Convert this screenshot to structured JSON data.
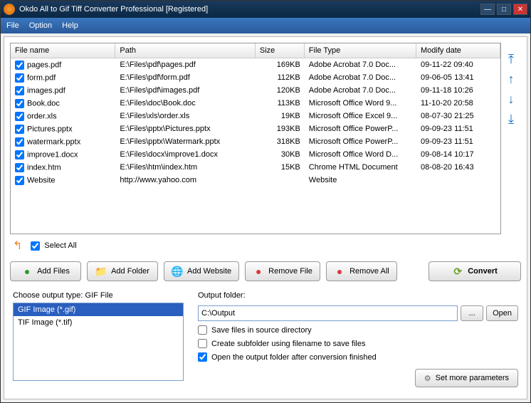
{
  "window": {
    "title": "Okdo All to Gif Tiff Converter Professional [Registered]"
  },
  "menu": {
    "file": "File",
    "option": "Option",
    "help": "Help"
  },
  "columns": {
    "name": "File name",
    "path": "Path",
    "size": "Size",
    "type": "File Type",
    "date": "Modify date"
  },
  "files": [
    {
      "checked": true,
      "name": "pages.pdf",
      "path": "E:\\Files\\pdf\\pages.pdf",
      "size": "169KB",
      "type": "Adobe Acrobat 7.0 Doc...",
      "date": "09-11-22 09:40"
    },
    {
      "checked": true,
      "name": "form.pdf",
      "path": "E:\\Files\\pdf\\form.pdf",
      "size": "112KB",
      "type": "Adobe Acrobat 7.0 Doc...",
      "date": "09-06-05 13:41"
    },
    {
      "checked": true,
      "name": "images.pdf",
      "path": "E:\\Files\\pdf\\images.pdf",
      "size": "120KB",
      "type": "Adobe Acrobat 7.0 Doc...",
      "date": "09-11-18 10:26"
    },
    {
      "checked": true,
      "name": "Book.doc",
      "path": "E:\\Files\\doc\\Book.doc",
      "size": "113KB",
      "type": "Microsoft Office Word 9...",
      "date": "11-10-20 20:58"
    },
    {
      "checked": true,
      "name": "order.xls",
      "path": "E:\\Files\\xls\\order.xls",
      "size": "19KB",
      "type": "Microsoft Office Excel 9...",
      "date": "08-07-30 21:25"
    },
    {
      "checked": true,
      "name": "Pictures.pptx",
      "path": "E:\\Files\\pptx\\Pictures.pptx",
      "size": "193KB",
      "type": "Microsoft Office PowerP...",
      "date": "09-09-23 11:51"
    },
    {
      "checked": true,
      "name": "watermark.pptx",
      "path": "E:\\Files\\pptx\\Watermark.pptx",
      "size": "318KB",
      "type": "Microsoft Office PowerP...",
      "date": "09-09-23 11:51"
    },
    {
      "checked": true,
      "name": "improve1.docx",
      "path": "E:\\Files\\docx\\improve1.docx",
      "size": "30KB",
      "type": "Microsoft Office Word D...",
      "date": "09-08-14 10:17"
    },
    {
      "checked": true,
      "name": "index.htm",
      "path": "E:\\Files\\htm\\index.htm",
      "size": "15KB",
      "type": "Chrome HTML Document",
      "date": "08-08-20 16:43"
    },
    {
      "checked": true,
      "name": "Website",
      "path": "http://www.yahoo.com",
      "size": "",
      "type": "Website",
      "date": ""
    }
  ],
  "select_all": "Select All",
  "buttons": {
    "add_files": "Add Files",
    "add_folder": "Add Folder",
    "add_website": "Add Website",
    "remove_file": "Remove File",
    "remove_all": "Remove All",
    "convert": "Convert"
  },
  "output_type": {
    "label": "Choose output type:",
    "current": "GIF File",
    "options": [
      {
        "label": "GIF Image (*.gif)",
        "selected": true
      },
      {
        "label": "TIF Image (*.tif)",
        "selected": false
      }
    ]
  },
  "output_settings": {
    "folder_label": "Output folder:",
    "folder_value": "C:\\Output",
    "browse": "...",
    "open": "Open",
    "save_in_source": {
      "checked": false,
      "label": "Save files in source directory"
    },
    "create_subfolder": {
      "checked": false,
      "label": "Create subfolder using filename to save files"
    },
    "open_after": {
      "checked": true,
      "label": "Open the output folder after conversion finished"
    },
    "more_params": "Set more parameters"
  }
}
